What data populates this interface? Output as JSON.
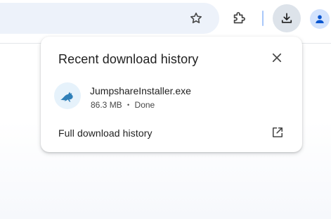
{
  "toolbar": {
    "icons": [
      "star-icon",
      "extensions-icon",
      "download-icon",
      "profile-icon"
    ],
    "colors": {
      "download_button_bg": "#dde3ea",
      "profile_bg": "#d3e3fd",
      "separator": "#a8c7fa"
    }
  },
  "popup": {
    "title": "Recent download history",
    "close_icon": "close-icon",
    "items": [
      {
        "icon": "kangaroo-icon",
        "name": "JumpshareInstaller.exe",
        "size": "86.3 MB",
        "separator": "•",
        "status": "Done"
      }
    ],
    "full_history_label": "Full download history",
    "open_icon": "open-in-new-icon"
  }
}
